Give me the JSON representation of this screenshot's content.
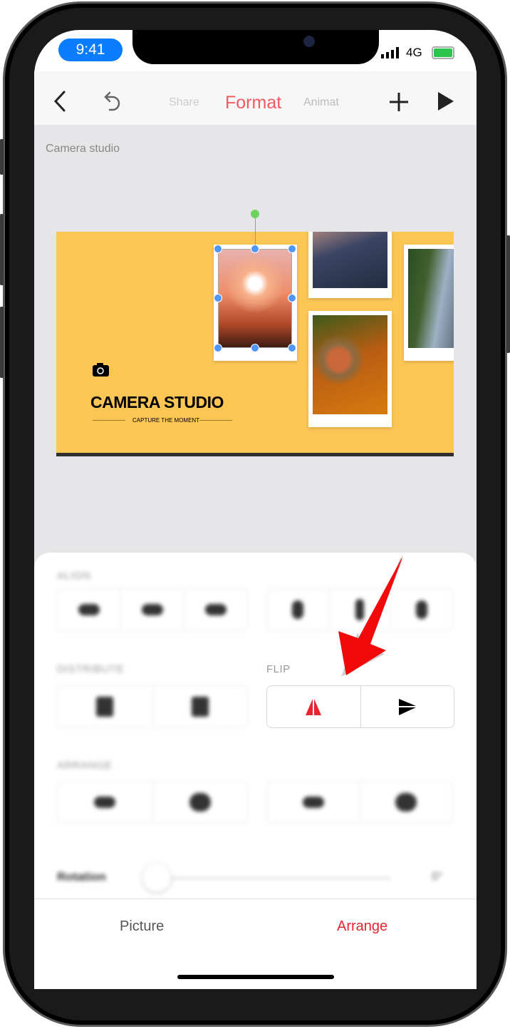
{
  "status_bar": {
    "time": "9:41",
    "network": "4G"
  },
  "toolbar": {
    "tabs": [
      "Share",
      "Format",
      "Animat"
    ],
    "active_tab": "Format",
    "accent": "#f0525a"
  },
  "document": {
    "title": "Camera studio"
  },
  "slide": {
    "title": "CAMERA STUDIO",
    "subtitle": "CAPTURE THE MOMENT",
    "background": "#fcc655"
  },
  "panel": {
    "align_label": "ALIGN",
    "distribute_label": "DISTRIBUTE",
    "flip_label": "FLIP",
    "arrange_label": "ARRANGE",
    "rotation_label": "Rotation",
    "rotation_value": "0°",
    "flip_buttons": [
      {
        "icon": "flip-horizontal-icon",
        "color": "#e5262f"
      },
      {
        "icon": "flip-vertical-icon",
        "color": "#000000"
      }
    ]
  },
  "bottom_tabs": {
    "picture": "Picture",
    "arrange": "Arrange",
    "active": "Arrange",
    "accent": "#e5262f"
  }
}
